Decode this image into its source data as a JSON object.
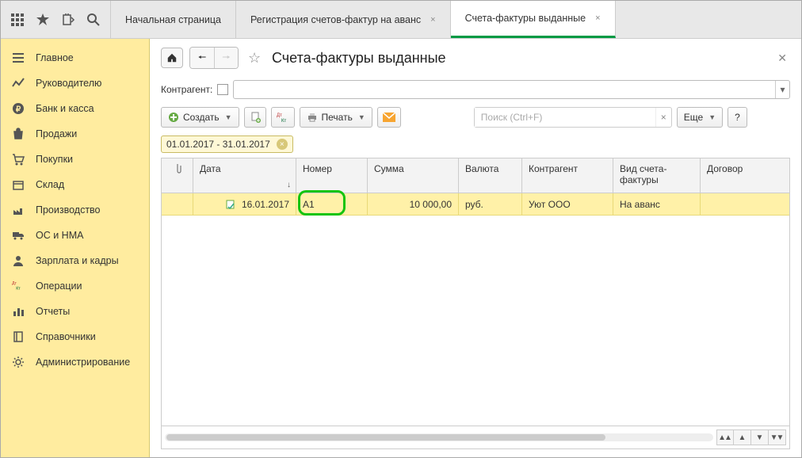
{
  "tabs": [
    {
      "label": "Начальная страница",
      "closable": false,
      "active": false
    },
    {
      "label": "Регистрация счетов-фактур на аванс",
      "closable": true,
      "active": false
    },
    {
      "label": "Счета-фактуры выданные",
      "closable": true,
      "active": true
    }
  ],
  "sidebar": [
    {
      "label": "Главное",
      "icon": "home"
    },
    {
      "label": "Руководителю",
      "icon": "chart"
    },
    {
      "label": "Банк и касса",
      "icon": "ruble"
    },
    {
      "label": "Продажи",
      "icon": "bag"
    },
    {
      "label": "Покупки",
      "icon": "cart"
    },
    {
      "label": "Склад",
      "icon": "box"
    },
    {
      "label": "Производство",
      "icon": "factory"
    },
    {
      "label": "ОС и НМА",
      "icon": "truck"
    },
    {
      "label": "Зарплата и кадры",
      "icon": "person"
    },
    {
      "label": "Операции",
      "icon": "ops"
    },
    {
      "label": "Отчеты",
      "icon": "bars"
    },
    {
      "label": "Справочники",
      "icon": "book"
    },
    {
      "label": "Администрирование",
      "icon": "gear"
    }
  ],
  "page": {
    "title": "Счета-фактуры выданные",
    "contractor_label": "Контрагент:",
    "date_filter": "01.01.2017 - 31.01.2017"
  },
  "toolbar": {
    "create": "Создать",
    "print": "Печать",
    "more": "Еще",
    "help": "?",
    "search_placeholder": "Поиск (Ctrl+F)"
  },
  "table": {
    "columns": {
      "clip": "",
      "date": "Дата",
      "number": "Номер",
      "sum": "Сумма",
      "currency": "Валюта",
      "contractor": "Контрагент",
      "type": "Вид счета-фактуры",
      "contract": "Договор"
    },
    "rows": [
      {
        "date": "16.01.2017",
        "number": "А1",
        "sum": "10 000,00",
        "currency": "руб.",
        "contractor": "Уют ООО",
        "type": "На аванс",
        "contract": ""
      }
    ]
  }
}
